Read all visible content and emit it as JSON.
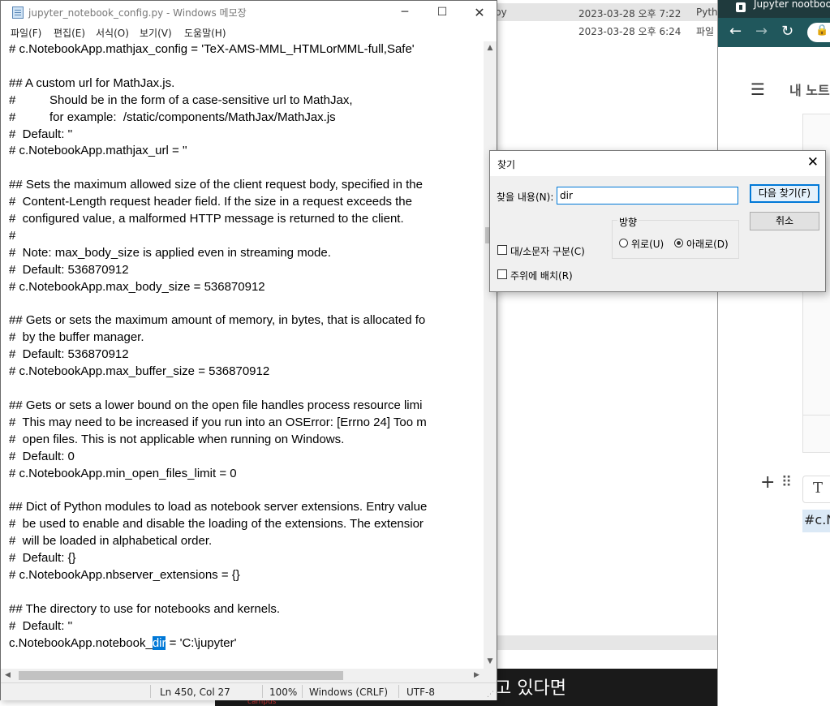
{
  "explorer": {
    "rows": [
      {
        "name": "py",
        "date": "2023-03-28 오후 7:22",
        "type": "Pytho",
        "selected": true
      },
      {
        "name": "",
        "date": "2023-03-28 오후 6:24",
        "type": "파일",
        "selected": false
      }
    ]
  },
  "video": {
    "caption": "고 있다면",
    "logo": "campus"
  },
  "browser": {
    "tab_title": "Jupyter nootbook",
    "page_title": "내 노트",
    "code_text": "#c.N",
    "text_button": "T"
  },
  "notepad": {
    "title": "jupyter_notebook_config.py - Windows 메모장",
    "menu": [
      "파일(F)",
      "편집(E)",
      "서식(O)",
      "보기(V)",
      "도움말(H)"
    ],
    "lines": [
      "# c.NotebookApp.mathjax_config = 'TeX-AMS-MML_HTMLorMML-full,Safe'",
      "",
      "## A custom url for MathJax.js.",
      "#          Should be in the form of a case-sensitive url to MathJax,",
      "#          for example:  /static/components/MathJax/MathJax.js",
      "#  Default: ''",
      "# c.NotebookApp.mathjax_url = ''",
      "",
      "## Sets the maximum allowed size of the client request body, specified in the",
      "#  Content-Length request header field. If the size in a request exceeds the",
      "#  configured value, a malformed HTTP message is returned to the client.",
      "#",
      "#  Note: max_body_size is applied even in streaming mode.",
      "#  Default: 536870912",
      "# c.NotebookApp.max_body_size = 536870912",
      "",
      "## Gets or sets the maximum amount of memory, in bytes, that is allocated fo",
      "#  by the buffer manager.",
      "#  Default: 536870912",
      "# c.NotebookApp.max_buffer_size = 536870912",
      "",
      "## Gets or sets a lower bound on the open file handles process resource limi",
      "#  This may need to be increased if you run into an OSError: [Errno 24] Too m",
      "#  open files. This is not applicable when running on Windows.",
      "#  Default: 0",
      "# c.NotebookApp.min_open_files_limit = 0",
      "",
      "## Dict of Python modules to load as notebook server extensions. Entry value",
      "#  be used to enable and disable the loading of the extensions. The extensior",
      "#  will be loaded in alphabetical order.",
      "#  Default: {}",
      "# c.NotebookApp.nbserver_extensions = {}",
      "",
      "## The directory to use for notebooks and kernels.",
      "#  Default: ''"
    ],
    "last_line": {
      "before": "c.NotebookApp.notebook_",
      "highlight": "dir",
      "after": " = 'C:\\jupyter'"
    },
    "status": {
      "position": "Ln 450, Col 27",
      "zoom": "100%",
      "line_ending": "Windows (CRLF)",
      "encoding": "UTF-8"
    }
  },
  "find_dialog": {
    "title": "찾기",
    "find_label": "찾을 내용(N):",
    "find_value": "dir",
    "find_next_label": "다음 찾기(F)",
    "cancel_label": "취소",
    "direction_label": "방향",
    "up_label": "위로(U)",
    "down_label": "아래로(D)",
    "direction_selected": "down",
    "match_case_label": "대/소문자 구분(C)",
    "match_case_checked": false,
    "wrap_label": "주위에 배치(R)",
    "wrap_checked": false
  }
}
